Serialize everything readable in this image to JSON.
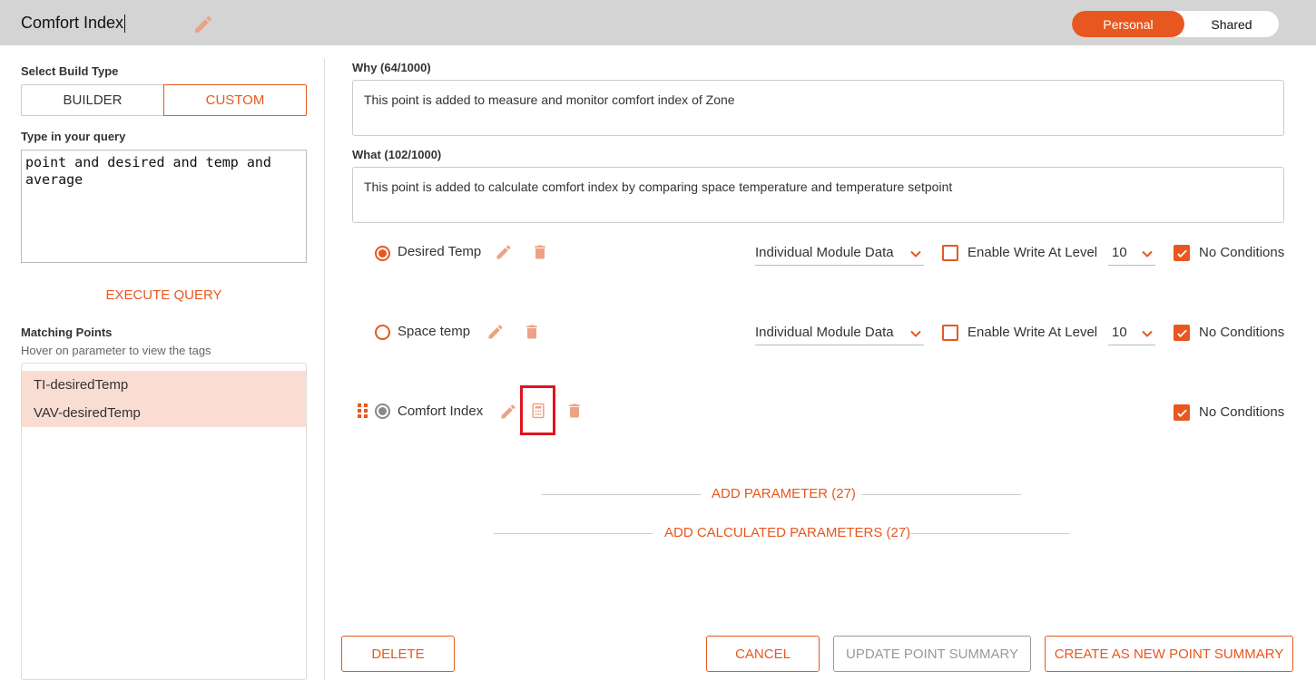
{
  "header": {
    "title": "Comfort Index",
    "scope_options": [
      "Personal",
      "Shared"
    ],
    "scope_selected": "Personal"
  },
  "left": {
    "build_type_label": "Select Build Type",
    "build_types": [
      "BUILDER",
      "CUSTOM"
    ],
    "build_type_selected": "CUSTOM",
    "query_label": "Type in your query",
    "query_value": "point and desired and temp and average",
    "execute_label": "EXECUTE QUERY",
    "matching_label": "Matching Points",
    "matching_hint": "Hover on parameter to view the tags",
    "matching_points": [
      "TI-desiredTemp",
      "VAV-desiredTemp"
    ]
  },
  "why": {
    "label": "Why (64/1000)",
    "value": "This point is added to measure and monitor comfort index of Zone"
  },
  "what": {
    "label": "What (102/1000)",
    "value": "This point is added to calculate comfort index by comparing space temperature and temperature setpoint"
  },
  "parameters": [
    {
      "name": "Desired Temp",
      "selected": true,
      "data_source": "Individual Module Data",
      "enable_write_label": "Enable Write At Level",
      "enable_write": false,
      "level": "10",
      "no_conditions_label": "No Conditions",
      "no_conditions": true
    },
    {
      "name": "Space temp",
      "selected": false,
      "data_source": "Individual Module Data",
      "enable_write_label": "Enable Write At Level",
      "enable_write": false,
      "level": "10",
      "no_conditions_label": "No Conditions",
      "no_conditions": true
    },
    {
      "name": "Comfort Index",
      "calculated": true,
      "no_conditions_label": "No Conditions",
      "no_conditions": true
    }
  ],
  "add_parameter_label": "ADD PARAMETER (27)",
  "add_calculated_label": "ADD CALCULATED PARAMETERS (27)",
  "footer": {
    "delete_label": "DELETE",
    "cancel_label": "CANCEL",
    "update_label": "UPDATE POINT SUMMARY",
    "create_label": "CREATE AS NEW POINT SUMMARY"
  },
  "colors": {
    "accent": "#e8571f",
    "highlight": "#e0131f",
    "match_bg": "#f9ddd2",
    "header_bg": "#d4d4d4"
  }
}
